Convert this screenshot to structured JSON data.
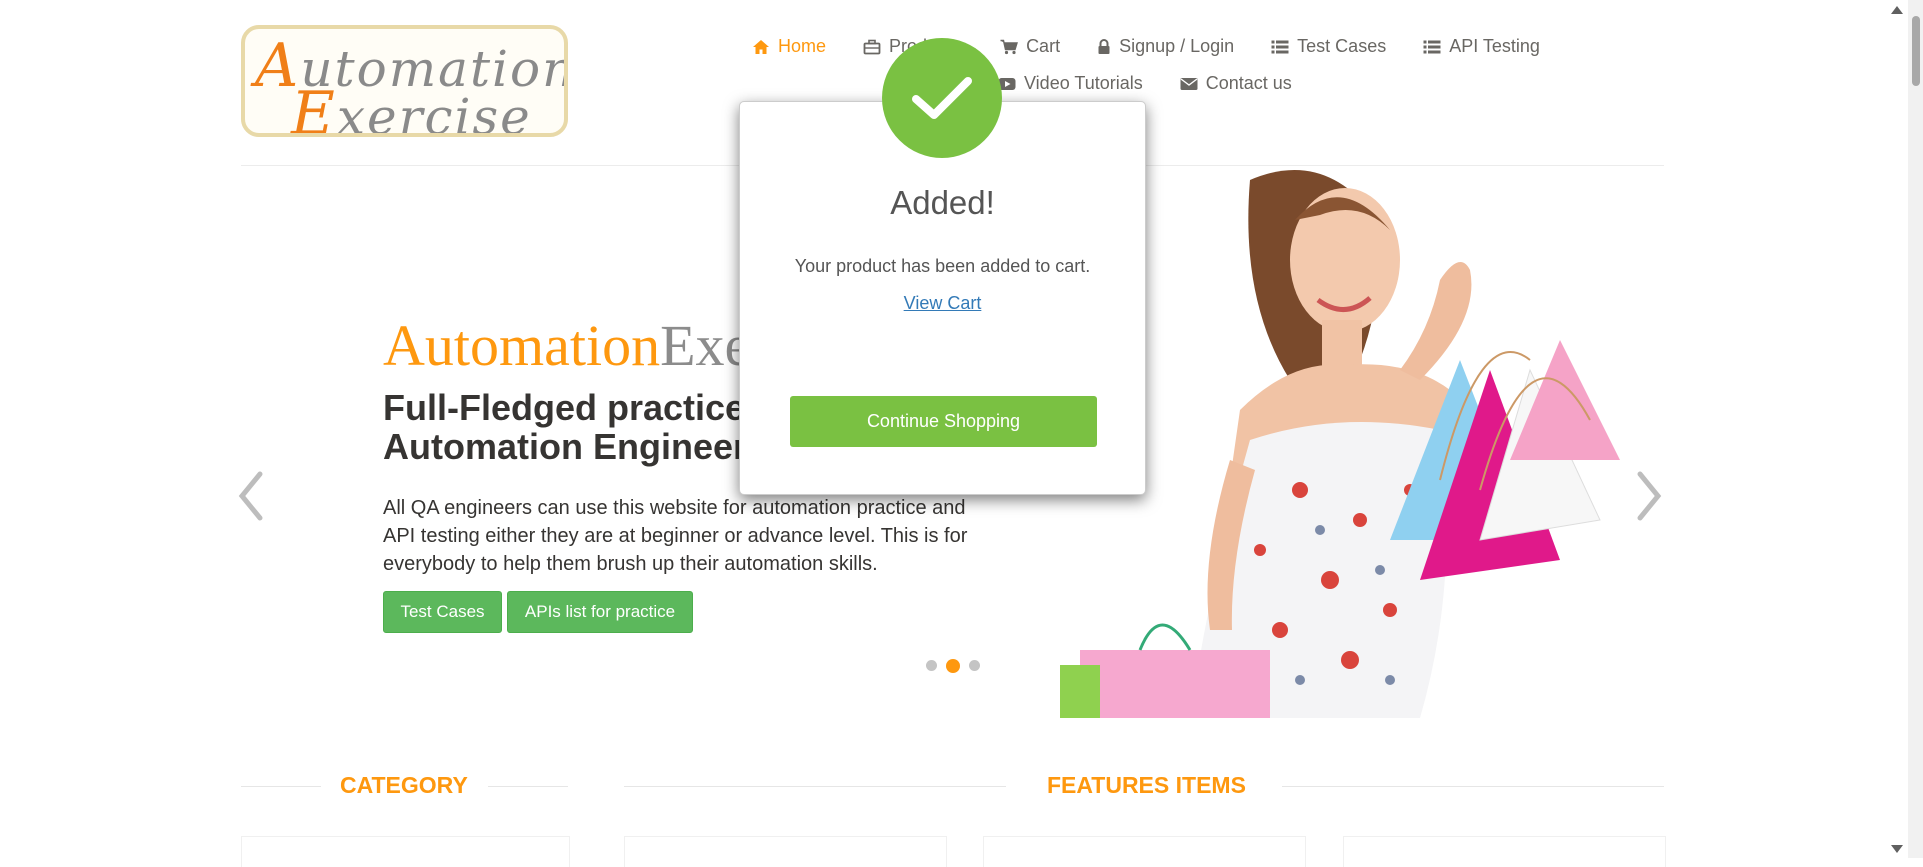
{
  "header": {
    "logo": {
      "line1_initial": "A",
      "line1_rest": "utomation",
      "line2_initial": "E",
      "line2_rest": "xercise"
    },
    "nav": [
      {
        "label": "Home",
        "icon": "home-icon",
        "active": true
      },
      {
        "label": "Products",
        "icon": "briefcase-icon",
        "active": false
      },
      {
        "label": "Cart",
        "icon": "cart-icon",
        "active": false
      },
      {
        "label": "Signup / Login",
        "icon": "lock-icon",
        "active": false
      },
      {
        "label": "Test Cases",
        "icon": "list-icon",
        "active": false
      },
      {
        "label": "API Testing",
        "icon": "list-icon",
        "active": false
      },
      {
        "label": "Video Tutorials",
        "icon": "youtube-icon",
        "active": false
      },
      {
        "label": "Contact us",
        "icon": "envelope-icon",
        "active": false
      }
    ]
  },
  "slider": {
    "brand_part1": "Automation",
    "brand_part2": "Exercise",
    "heading": "Full-Fledged practice website for Automation Engineers",
    "description": "All QA engineers can use this website for automation practice and API testing either they are at beginner or advance level. This is for everybody to help them brush up their automation skills.",
    "test_cases_button": "Test Cases",
    "apis_button": "APIs list for practice",
    "active_slide": 2,
    "slide_count": 3
  },
  "sections": {
    "category_title": "CATEGORY",
    "features_title": "FEATURES ITEMS"
  },
  "modal": {
    "title": "Added!",
    "body": "Your product has been added to cart.",
    "view_cart_link": "View Cart",
    "continue_button": "Continue Shopping"
  },
  "colors": {
    "accent": "#fe980f",
    "success": "#7ac142",
    "button_green": "#5cb85c",
    "link": "#337ab7"
  }
}
